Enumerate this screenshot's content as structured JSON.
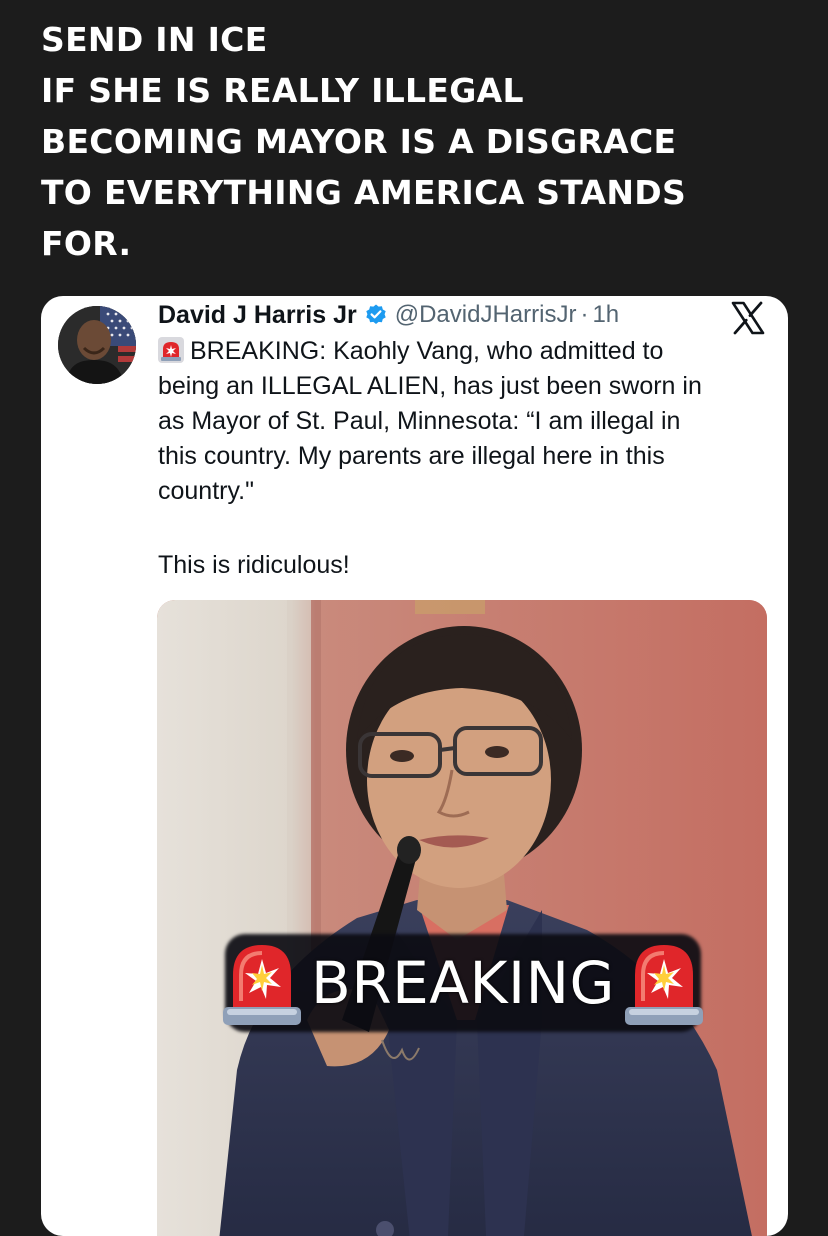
{
  "headline": {
    "lines": [
      "SEND IN ICE",
      "IF SHE IS REALLY ILLEGAL",
      "BECOMING MAYOR IS A DISGRACE",
      "TO EVERYTHING AMERICA STANDS",
      "FOR."
    ]
  },
  "tweet": {
    "author": "David J Harris Jr",
    "handle": "@DavidJHarrisJr",
    "separator": "·",
    "time": "1h",
    "platform_icon": "x-logo-icon",
    "verified_icon": "verified-badge-icon",
    "alarm_icon": "police-siren-icon",
    "body_lines": [
      "BREAKING: Kaohly Vang, who admitted to",
      "being an ILLEGAL ALIEN, has just been sworn in",
      "as Mayor of St. Paul, Minnesota: “I am illegal in",
      "this country. My parents are illegal here in this",
      "country.\""
    ],
    "comment": "This is ridiculous!",
    "media": {
      "banner_text": "BREAKING"
    }
  },
  "colors": {
    "background": "#1c1c1c",
    "card": "#ffffff",
    "verified": "#1d9bf0",
    "siren_red": "#e0262a"
  }
}
